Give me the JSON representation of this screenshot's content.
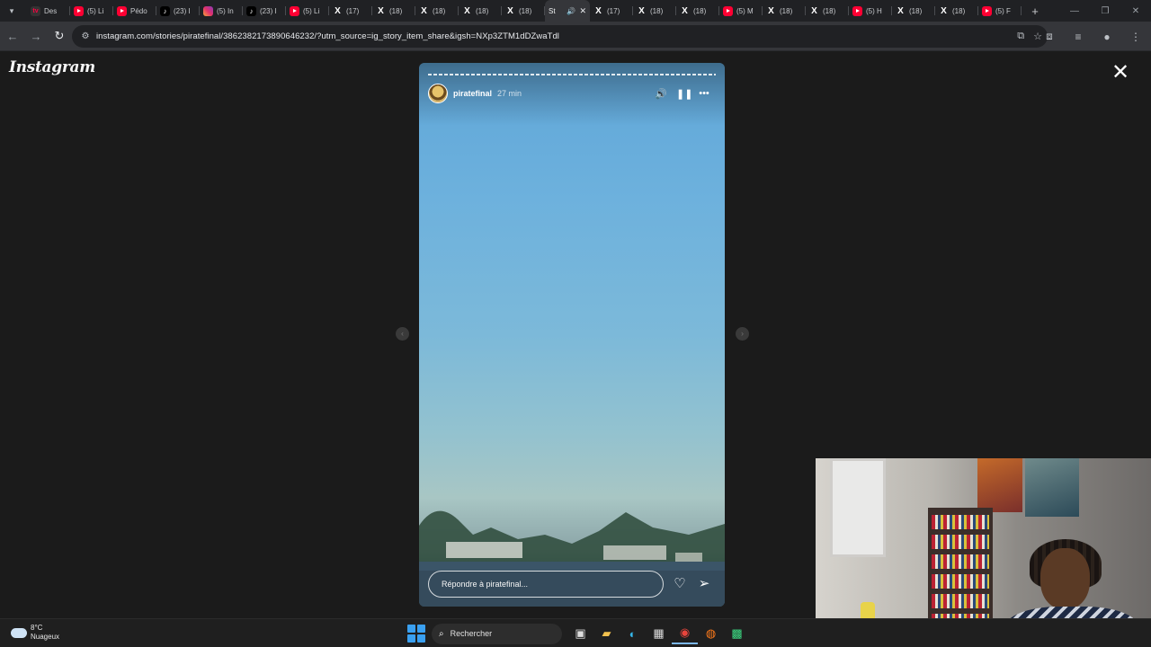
{
  "browser": {
    "tabs": [
      {
        "fav": "tv",
        "glyph": "tv",
        "label": "Des"
      },
      {
        "fav": "yt",
        "glyph": "",
        "label": "(5) Li"
      },
      {
        "fav": "yt",
        "glyph": "",
        "label": "Pédo"
      },
      {
        "fav": "tt",
        "glyph": "♪",
        "label": "(23) I"
      },
      {
        "fav": "ig",
        "glyph": "",
        "label": "(5) In"
      },
      {
        "fav": "tt",
        "glyph": "♪",
        "label": "(23) I"
      },
      {
        "fav": "yt",
        "glyph": "",
        "label": "(5) Li"
      },
      {
        "fav": "x",
        "glyph": "X",
        "label": "(17)"
      },
      {
        "fav": "x",
        "glyph": "X",
        "label": "(18)"
      },
      {
        "fav": "x",
        "glyph": "X",
        "label": "(18)"
      },
      {
        "fav": "x",
        "glyph": "X",
        "label": "(18)"
      },
      {
        "fav": "x",
        "glyph": "X",
        "label": "(18)"
      },
      {
        "fav": "active",
        "glyph": "",
        "label": "St"
      },
      {
        "fav": "x",
        "glyph": "X",
        "label": "(17)"
      },
      {
        "fav": "x",
        "glyph": "X",
        "label": "(18)"
      },
      {
        "fav": "x",
        "glyph": "X",
        "label": "(18)"
      },
      {
        "fav": "yt",
        "glyph": "",
        "label": "(5) M"
      },
      {
        "fav": "x",
        "glyph": "X",
        "label": "(18)"
      },
      {
        "fav": "x",
        "glyph": "X",
        "label": "(18)"
      },
      {
        "fav": "yt",
        "glyph": "",
        "label": "(5) H"
      },
      {
        "fav": "x",
        "glyph": "X",
        "label": "(18)"
      },
      {
        "fav": "x",
        "glyph": "X",
        "label": "(18)"
      },
      {
        "fav": "yt",
        "glyph": "",
        "label": "(5) F"
      }
    ],
    "url": "instagram.com/stories/piratefinal/3862382173890646232/?utm_source=ig_story_item_share&igsh=NXp3ZTM1dDZwaTdl"
  },
  "page": {
    "logo": "Instagram"
  },
  "story": {
    "username": "piratefinal",
    "time": "27 min",
    "reply_placeholder": "Répondre à piratefinal..."
  },
  "taskbar": {
    "temperature": "8°C",
    "condition": "Nuageux",
    "search_label": "Rechercher"
  }
}
